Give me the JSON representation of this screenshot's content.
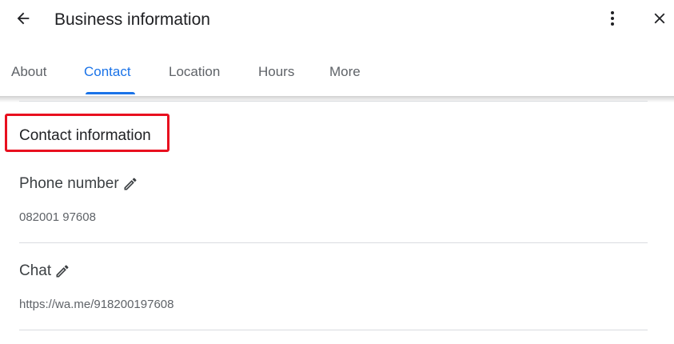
{
  "header": {
    "title": "Business information",
    "back_icon": "arrow-left-icon",
    "more_icon": "more-vert-icon",
    "close_icon": "close-icon"
  },
  "tabs": [
    {
      "label": "About",
      "active": false
    },
    {
      "label": "Contact",
      "active": true
    },
    {
      "label": "Location",
      "active": false
    },
    {
      "label": "Hours",
      "active": false
    },
    {
      "label": "More",
      "active": false
    }
  ],
  "contact": {
    "section_title": "Contact information",
    "fields": [
      {
        "label": "Phone number",
        "value": "082001 97608",
        "edit_icon": "pencil-icon"
      },
      {
        "label": "Chat",
        "value": "https://wa.me/918200197608",
        "edit_icon": "pencil-icon"
      }
    ]
  },
  "colors": {
    "accent": "#1a73e8",
    "highlight": "#e8101f",
    "divider": "#dadce0"
  }
}
